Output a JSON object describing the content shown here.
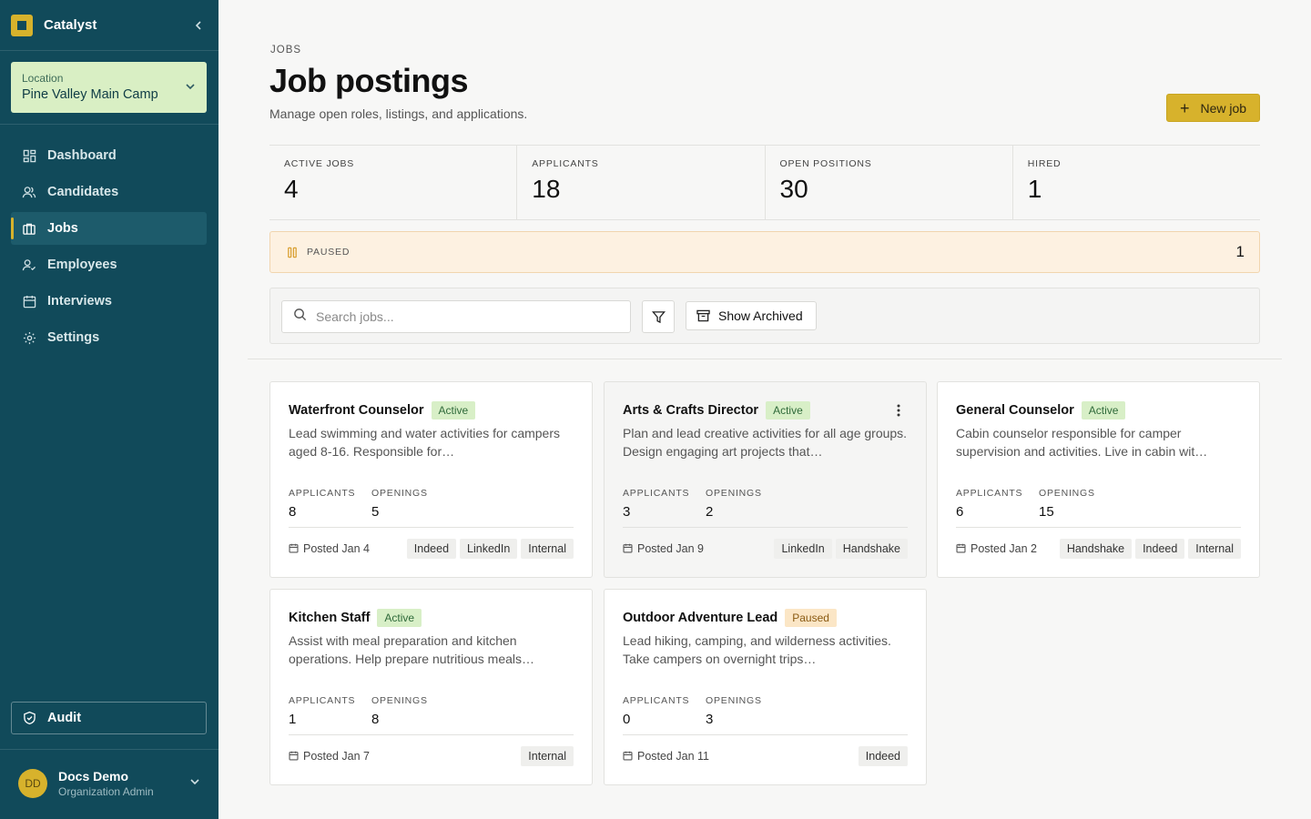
{
  "brand": {
    "name": "Catalyst",
    "color": "#d7b22c"
  },
  "location": {
    "label": "Location",
    "value": "Pine Valley Main Camp"
  },
  "nav": [
    {
      "label": "Dashboard",
      "icon": "dashboard-icon"
    },
    {
      "label": "Candidates",
      "icon": "users-icon"
    },
    {
      "label": "Jobs",
      "icon": "briefcase-icon",
      "active": true
    },
    {
      "label": "Employees",
      "icon": "user-check-icon"
    },
    {
      "label": "Interviews",
      "icon": "calendar-icon"
    },
    {
      "label": "Settings",
      "icon": "gear-icon"
    }
  ],
  "audit": {
    "label": "Audit"
  },
  "user": {
    "initials": "DD",
    "name": "Docs Demo",
    "role": "Organization Admin"
  },
  "header": {
    "eyebrow": "JOBS",
    "title": "Job postings",
    "subtitle": "Manage open roles, listings, and applications.",
    "new_button": "New job"
  },
  "stats": [
    {
      "label": "ACTIVE JOBS",
      "value": "4"
    },
    {
      "label": "APPLICANTS",
      "value": "18"
    },
    {
      "label": "OPEN POSITIONS",
      "value": "30"
    },
    {
      "label": "HIRED",
      "value": "1"
    }
  ],
  "paused": {
    "label": "PAUSED",
    "count": "1"
  },
  "toolbar": {
    "search_placeholder": "Search jobs...",
    "archive_label": "Show Archived"
  },
  "cards": [
    {
      "title": "Waterfront Counselor",
      "status": "Active",
      "desc": "Lead swimming and water activities for campers aged 8-16. Responsible for…",
      "applicants_label": "APPLICANTS",
      "applicants": "8",
      "openings_label": "OPENINGS",
      "openings": "5",
      "posted": "Posted Jan 4",
      "tags": [
        "Indeed",
        "LinkedIn",
        "Internal"
      ]
    },
    {
      "title": "Arts & Crafts Director",
      "status": "Active",
      "desc": "Plan and lead creative activities for all age groups. Design engaging art projects that…",
      "applicants_label": "APPLICANTS",
      "applicants": "3",
      "openings_label": "OPENINGS",
      "openings": "2",
      "posted": "Posted Jan 9",
      "tags": [
        "LinkedIn",
        "Handshake"
      ]
    },
    {
      "title": "General Counselor",
      "status": "Active",
      "desc": "Cabin counselor responsible for camper supervision and activities. Live in cabin wit…",
      "applicants_label": "APPLICANTS",
      "applicants": "6",
      "openings_label": "OPENINGS",
      "openings": "15",
      "posted": "Posted Jan 2",
      "tags": [
        "Handshake",
        "Indeed",
        "Internal"
      ]
    },
    {
      "title": "Kitchen Staff",
      "status": "Active",
      "desc": "Assist with meal preparation and kitchen operations. Help prepare nutritious meals…",
      "applicants_label": "APPLICANTS",
      "applicants": "1",
      "openings_label": "OPENINGS",
      "openings": "8",
      "posted": "Posted Jan 7",
      "tags": [
        "Internal"
      ]
    },
    {
      "title": "Outdoor Adventure Lead",
      "status": "Paused",
      "desc": "Lead hiking, camping, and wilderness activities. Take campers on overnight trips…",
      "applicants_label": "APPLICANTS",
      "applicants": "0",
      "openings_label": "OPENINGS",
      "openings": "3",
      "posted": "Posted Jan 11",
      "tags": [
        "Indeed"
      ]
    }
  ]
}
